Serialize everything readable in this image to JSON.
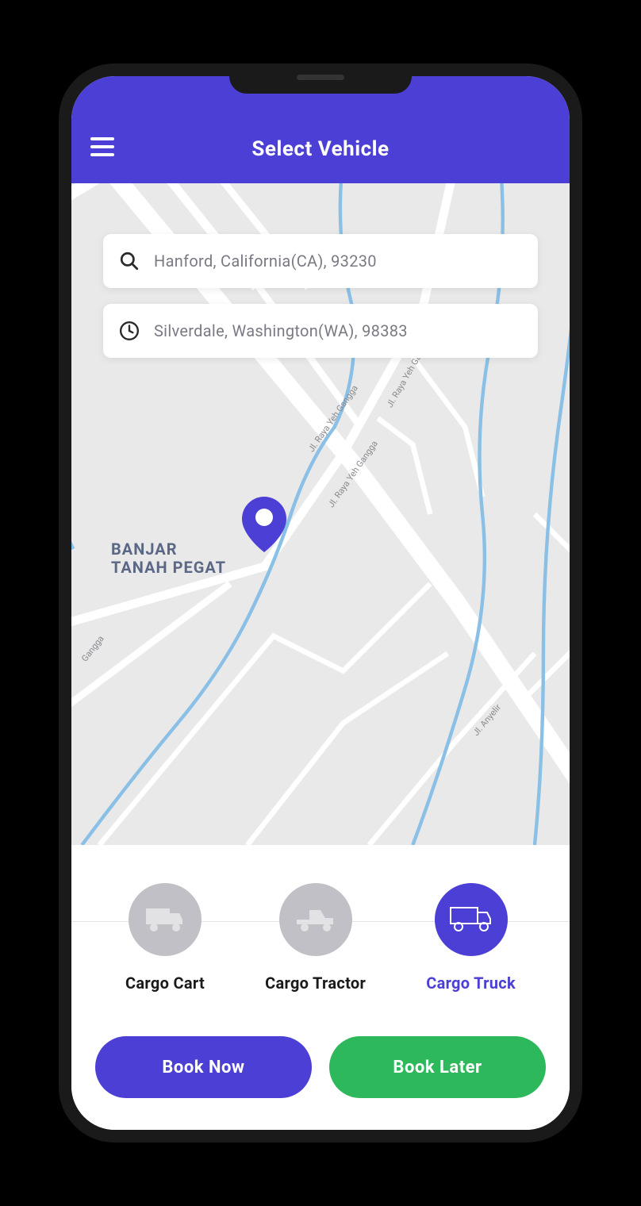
{
  "header": {
    "title": "Select Vehicle"
  },
  "search": {
    "origin": "Hanford, California(CA), 93230",
    "destination": "Silverdale, Washington(WA), 98383"
  },
  "map": {
    "place_label_line1": "BANJAR",
    "place_label_line2": "TANAH PEGAT",
    "road_labels": {
      "r1": "Jl. Raya Yeh Gangga",
      "r2": "Jl. Raya Yeh Gangga",
      "r3": "Jl. Raya Yeh Gan",
      "r4": "Gangga",
      "r5": "Jl. Anyelir"
    }
  },
  "vehicles": [
    {
      "label": "Cargo Cart",
      "selected": false
    },
    {
      "label": "Cargo Tractor",
      "selected": false
    },
    {
      "label": "Cargo Truck",
      "selected": true
    }
  ],
  "actions": {
    "book_now": "Book Now",
    "book_later": "Book Later"
  },
  "colors": {
    "accent": "#4b3fd6",
    "success": "#2eb85c"
  }
}
